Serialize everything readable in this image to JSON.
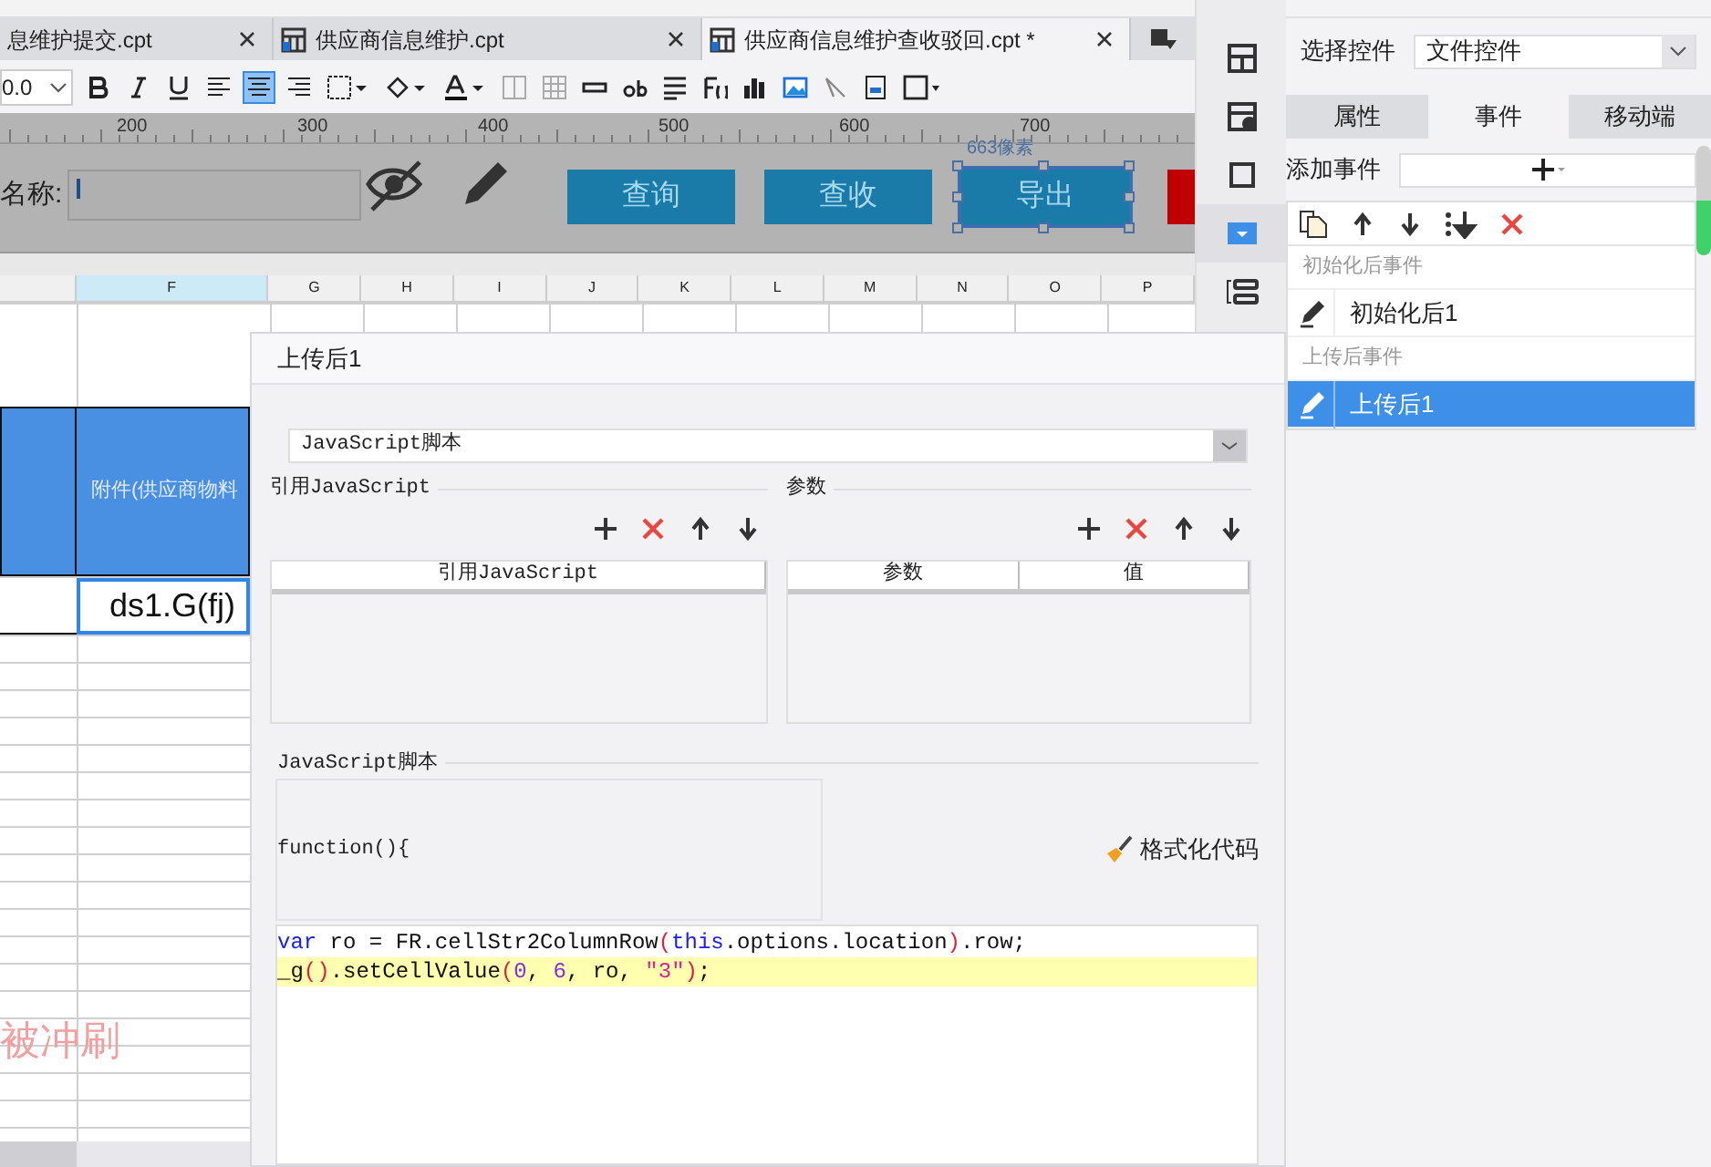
{
  "file_tabs": [
    {
      "label": "息维护提交.cpt",
      "selected": false
    },
    {
      "label": "供应商信息维护.cpt",
      "selected": false
    },
    {
      "label": "供应商信息维护查收驳回.cpt *",
      "selected": true
    }
  ],
  "toolbar": {
    "font_size": "0.0",
    "align_center_selected": true
  },
  "ruler": [
    "200",
    "300",
    "400",
    "500",
    "600",
    "700"
  ],
  "form_preview": {
    "label": "名称:",
    "buttons": [
      {
        "label": "查询",
        "selected": false
      },
      {
        "label": "查收",
        "selected": false
      },
      {
        "label": "导出",
        "selected": true
      }
    ],
    "size_hint": "663像素"
  },
  "columns": [
    {
      "label": "F",
      "selected": true
    },
    {
      "label": "G",
      "selected": false
    },
    {
      "label": "H",
      "selected": false
    },
    {
      "label": "I",
      "selected": false
    },
    {
      "label": "J",
      "selected": false
    },
    {
      "label": "K",
      "selected": false
    },
    {
      "label": "L",
      "selected": false
    },
    {
      "label": "M",
      "selected": false
    },
    {
      "label": "N",
      "selected": false
    },
    {
      "label": "O",
      "selected": false
    },
    {
      "label": "P",
      "selected": false
    }
  ],
  "sheet": {
    "header_cell": "附件(供应商物料",
    "value_cell": "ds1.G(fj)",
    "note": "被冲刷"
  },
  "dialog": {
    "title": "上传后1",
    "type_select": "JavaScript脚本",
    "ref_section": "引用JavaScript",
    "ref_columns": [
      "引用JavaScript"
    ],
    "param_section": "参数",
    "param_columns": [
      "参数",
      "值"
    ],
    "script_section": "JavaScript脚本",
    "function_header": "function(){",
    "format_button": "格式化代码",
    "code": [
      {
        "highlighted": false,
        "tokens": [
          {
            "kind": "keyword",
            "text": "var"
          },
          {
            "kind": "plain",
            "text": " ro = FR.cellStr2ColumnRow"
          },
          {
            "kind": "paren",
            "text": "("
          },
          {
            "kind": "keyword",
            "text": "this"
          },
          {
            "kind": "plain",
            "text": ".options.location"
          },
          {
            "kind": "paren",
            "text": ")"
          },
          {
            "kind": "plain",
            "text": ".row;"
          }
        ]
      },
      {
        "highlighted": true,
        "tokens": [
          {
            "kind": "plain",
            "text": "_g"
          },
          {
            "kind": "paren",
            "text": "()"
          },
          {
            "kind": "plain",
            "text": ".setCellValue"
          },
          {
            "kind": "paren",
            "text": "("
          },
          {
            "kind": "number",
            "text": "0"
          },
          {
            "kind": "plain",
            "text": ", "
          },
          {
            "kind": "number",
            "text": "6"
          },
          {
            "kind": "plain",
            "text": ", ro, "
          },
          {
            "kind": "string",
            "text": "\"3\""
          },
          {
            "kind": "paren",
            "text": ")"
          },
          {
            "kind": "plain",
            "text": ";"
          }
        ]
      }
    ]
  },
  "panel": {
    "select_label": "选择控件",
    "select_value": "文件控件",
    "tabs": [
      {
        "label": "属性",
        "selected": false
      },
      {
        "label": "事件",
        "selected": true
      },
      {
        "label": "移动端",
        "selected": false
      }
    ],
    "add_event": "添加事件",
    "groups": [
      {
        "title": "初始化后事件",
        "events": [
          {
            "label": "初始化后1",
            "selected": false
          }
        ]
      },
      {
        "title": "上传后事件",
        "events": [
          {
            "label": "上传后1",
            "selected": true
          }
        ]
      }
    ]
  }
}
